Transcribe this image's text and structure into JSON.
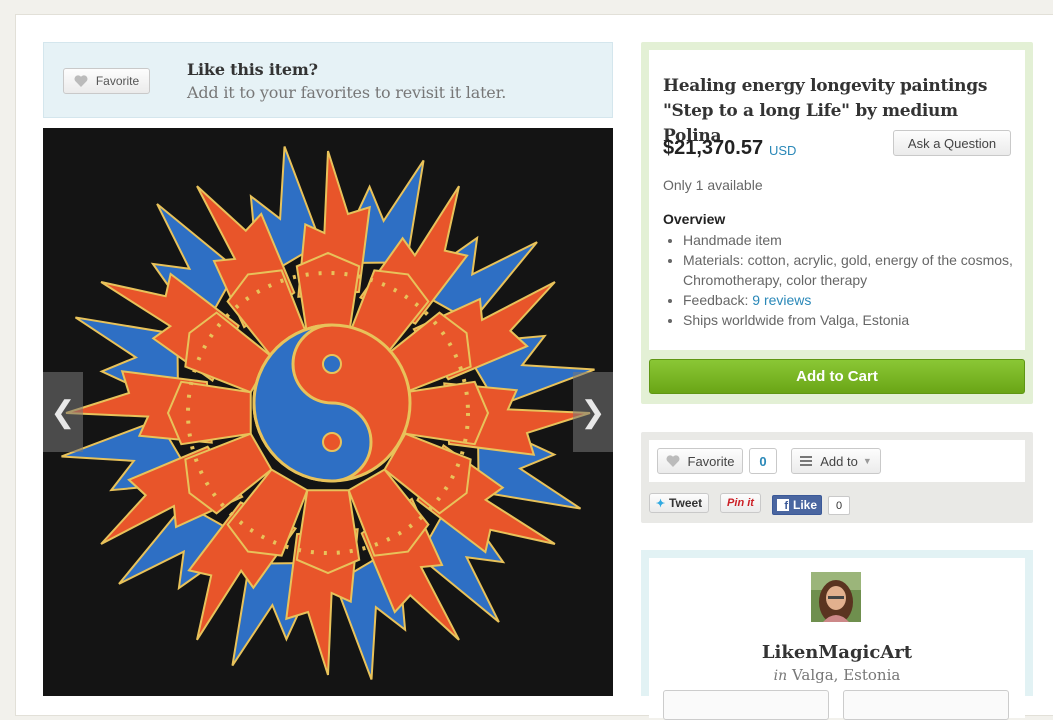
{
  "banner": {
    "favorite_label": "Favorite",
    "title": "Like this item?",
    "subtitle": "Add it to your favorites to revisit it later."
  },
  "image": {
    "prev_icon": "chevron-left-icon",
    "next_icon": "chevron-right-icon",
    "prev_glyph": "❮",
    "next_glyph": "❯"
  },
  "listing": {
    "title": "Healing energy longevity paintings \"Step to a long Life\" by medium Polina",
    "price": "$21,370.57",
    "currency": "USD",
    "ask_label": "Ask a Question",
    "availability": "Only 1 available",
    "overview_heading": "Overview",
    "overview": {
      "item1": "Handmade item",
      "item2": "Materials: cotton, acrylic, gold, energy of the cosmos, Chromotherapy, color therapy",
      "item3_prefix": "Feedback: ",
      "item3_link": "9 reviews",
      "item4": "Ships worldwide from Valga, Estonia"
    },
    "cart_label": "Add to Cart"
  },
  "social": {
    "favorite_label": "Favorite",
    "favorite_count": "0",
    "addto_label": "Add to",
    "tweet_label": "Tweet",
    "pinit_label": "Pin it",
    "like_label": "Like",
    "like_count": "0"
  },
  "shop": {
    "name": "LikenMagicArt",
    "in_word": "in",
    "location": "Valga, Estonia"
  },
  "colors": {
    "accent": "#2a88b8",
    "cart_green": "#7ab929",
    "painting_orange": "#e8552a",
    "painting_blue": "#2e6fc4"
  }
}
